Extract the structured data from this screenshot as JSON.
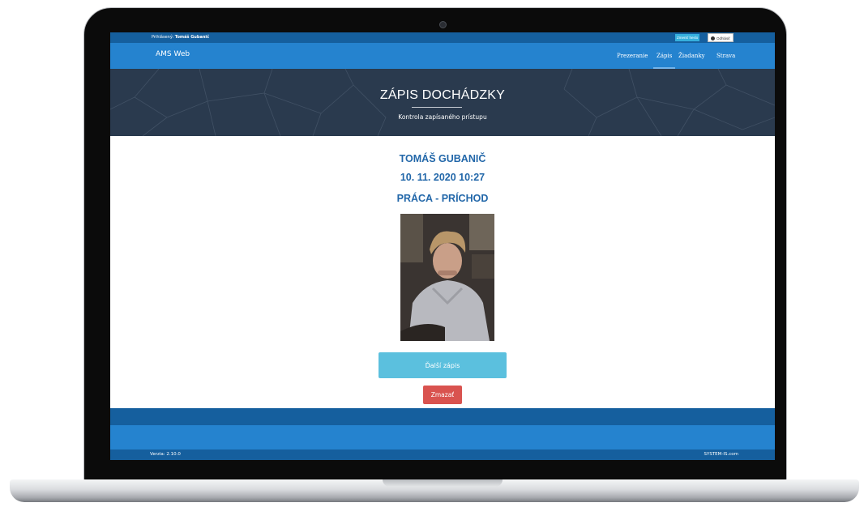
{
  "header": {
    "logged_in_label": "Prihlásený:",
    "logged_in_user": "Tomáš Gubanič",
    "change_password_label": "Zmeniť heslo",
    "logout_label": "Odhlásiť"
  },
  "navbar": {
    "brand": "AMS Web",
    "items": [
      {
        "label": "Prezeranie",
        "active": false
      },
      {
        "label": "Zápis",
        "active": true
      },
      {
        "label": "Žiadanky",
        "active": false
      },
      {
        "label": "Strava",
        "active": false
      }
    ]
  },
  "hero": {
    "title": "ZÁPIS DOCHÁDZKY",
    "subtitle": "Kontrola zapísaného prístupu"
  },
  "record": {
    "name": "TOMÁŠ GUBANIČ",
    "datetime": "10. 11. 2020 10:27",
    "type": "PRÁCA - PRÍCHOD"
  },
  "actions": {
    "next_label": "Ďalší zápis",
    "delete_label": "Zmazať"
  },
  "footer": {
    "version": "Verzia: 2.10.0",
    "company": "SYSTEM-IS.com"
  },
  "colors": {
    "dark_blue": "#155f9e",
    "nav_blue": "#2583cf",
    "hero_bg": "#2a3a4e",
    "accent_text": "#2267a9",
    "info_button": "#5bc0de",
    "danger_button": "#d9534f"
  },
  "icons": {
    "logout": "power-icon",
    "camera": "webcam-dot"
  }
}
